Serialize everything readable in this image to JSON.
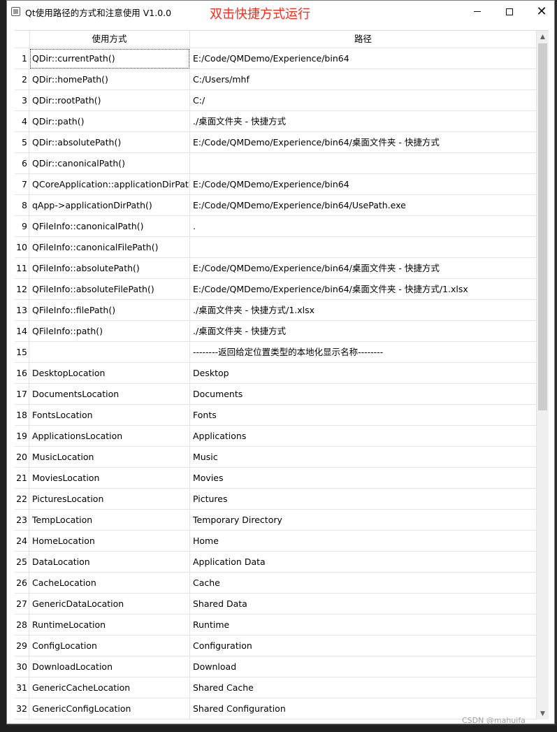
{
  "window": {
    "title": "Qt使用路径的方式和注意使用 V1.0.0",
    "annotation": "双击快捷方式运行",
    "min_icon": "window-minimize-icon",
    "max_icon": "window-maximize-icon",
    "close_icon": "close-icon"
  },
  "table": {
    "columns": [
      "使用方式",
      "路径"
    ],
    "rows": [
      {
        "num": "1",
        "method": "QDir::currentPath()",
        "path": "E:/Code/QMDemo/Experience/bin64"
      },
      {
        "num": "2",
        "method": "QDir::homePath()",
        "path": "C:/Users/mhf"
      },
      {
        "num": "3",
        "method": "QDir::rootPath()",
        "path": "C:/"
      },
      {
        "num": "4",
        "method": "QDir::path()",
        "path": "./桌面文件夹 - 快捷方式"
      },
      {
        "num": "5",
        "method": "QDir::absolutePath()",
        "path": "E:/Code/QMDemo/Experience/bin64/桌面文件夹 - 快捷方式"
      },
      {
        "num": "6",
        "method": "QDir::canonicalPath()",
        "path": ""
      },
      {
        "num": "7",
        "method": "QCoreApplication::applicationDirPath()",
        "path": "E:/Code/QMDemo/Experience/bin64"
      },
      {
        "num": "8",
        "method": "qApp->applicationDirPath()",
        "path": "E:/Code/QMDemo/Experience/bin64/UsePath.exe"
      },
      {
        "num": "9",
        "method": "QFileInfo::canonicalPath()",
        "path": "."
      },
      {
        "num": "10",
        "method": "QFileInfo::canonicalFilePath()",
        "path": ""
      },
      {
        "num": "11",
        "method": "QFileInfo::absolutePath()",
        "path": "E:/Code/QMDemo/Experience/bin64/桌面文件夹 - 快捷方式"
      },
      {
        "num": "12",
        "method": "QFileInfo::absoluteFilePath()",
        "path": "E:/Code/QMDemo/Experience/bin64/桌面文件夹 - 快捷方式/1.xlsx"
      },
      {
        "num": "13",
        "method": "QFileInfo::filePath()",
        "path": "./桌面文件夹 - 快捷方式/1.xlsx"
      },
      {
        "num": "14",
        "method": "QFileInfo::path()",
        "path": "./桌面文件夹 - 快捷方式"
      },
      {
        "num": "15",
        "method": "",
        "path": "--------返回给定位置类型的本地化显示名称--------"
      },
      {
        "num": "16",
        "method": "DesktopLocation",
        "path": "Desktop"
      },
      {
        "num": "17",
        "method": "DocumentsLocation",
        "path": "Documents"
      },
      {
        "num": "18",
        "method": "FontsLocation",
        "path": "Fonts"
      },
      {
        "num": "19",
        "method": "ApplicationsLocation",
        "path": "Applications"
      },
      {
        "num": "20",
        "method": "MusicLocation",
        "path": "Music"
      },
      {
        "num": "21",
        "method": "MoviesLocation",
        "path": "Movies"
      },
      {
        "num": "22",
        "method": "PicturesLocation",
        "path": "Pictures"
      },
      {
        "num": "23",
        "method": "TempLocation",
        "path": "Temporary Directory"
      },
      {
        "num": "24",
        "method": "HomeLocation",
        "path": "Home"
      },
      {
        "num": "25",
        "method": "DataLocation",
        "path": "Application Data"
      },
      {
        "num": "26",
        "method": "CacheLocation",
        "path": "Cache"
      },
      {
        "num": "27",
        "method": "GenericDataLocation",
        "path": "Shared Data"
      },
      {
        "num": "28",
        "method": "RuntimeLocation",
        "path": "Runtime"
      },
      {
        "num": "29",
        "method": "ConfigLocation",
        "path": "Configuration"
      },
      {
        "num": "30",
        "method": "DownloadLocation",
        "path": "Download"
      },
      {
        "num": "31",
        "method": "GenericCacheLocation",
        "path": "Shared Cache"
      },
      {
        "num": "32",
        "method": "GenericConfigLocation",
        "path": "Shared Configuration"
      }
    ]
  },
  "watermark": "CSDN @mahuifa"
}
